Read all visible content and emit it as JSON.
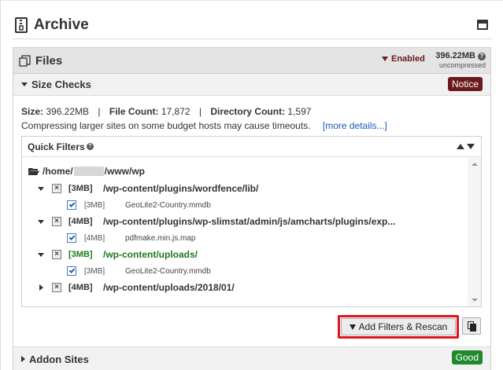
{
  "archive": {
    "title": "Archive"
  },
  "files": {
    "title": "Files",
    "status": "Enabled",
    "size": "396.22MB",
    "size_note": "uncompressed",
    "help": "?"
  },
  "size_checks": {
    "title": "Size Checks",
    "badge": "Notice",
    "size_label": "Size:",
    "size_value": "396.22MB",
    "count_label": "File Count:",
    "count_value": "17,872",
    "dir_label": "Directory Count:",
    "dir_value": "1,597",
    "separator": "|",
    "warning": "Compressing larger sites on some budget hosts may cause timeouts.",
    "more_link": "[more details...]"
  },
  "quick_filters": {
    "title": "Quick Filters",
    "help": "?",
    "root": {
      "prefix": "/home/",
      "suffix": "/www/wp"
    },
    "rows": [
      {
        "type": "dir",
        "size": "[3MB]",
        "path": "/wp-content/plugins/wordfence/lib/"
      },
      {
        "type": "file",
        "size": "[3MB]",
        "name": "GeoLite2-Country.mmdb"
      },
      {
        "type": "dir",
        "size": "[4MB]",
        "path": "/wp-content/plugins/wp-slimstat/admin/js/amcharts/plugins/exp..."
      },
      {
        "type": "file",
        "size": "[4MB]",
        "name": "pdfmake.min.js.map"
      },
      {
        "type": "dir",
        "size": "[3MB]",
        "path": "/wp-content/uploads/"
      },
      {
        "type": "file",
        "size": "[3MB]",
        "name": "GeoLite2-Country.mmdb"
      },
      {
        "type": "dir",
        "size": "[4MB]",
        "path": "/wp-content/uploads/2018/01/"
      }
    ]
  },
  "actions": {
    "rescan_label": "Add Filters & Rescan"
  },
  "addon_sites": {
    "title": "Addon Sites",
    "badge": "Good"
  },
  "colors": {
    "notice": "#6b1a1a",
    "good": "#1e8a2b",
    "highlight": "#e0141e",
    "link": "#1a5ab8",
    "green_path": "#1b7a1b"
  },
  "icons": [
    "archive-icon",
    "window-icon",
    "files-icon",
    "funnel-icon",
    "folder-icon",
    "x-box-icon",
    "checkbox-icon",
    "copy-icon"
  ]
}
